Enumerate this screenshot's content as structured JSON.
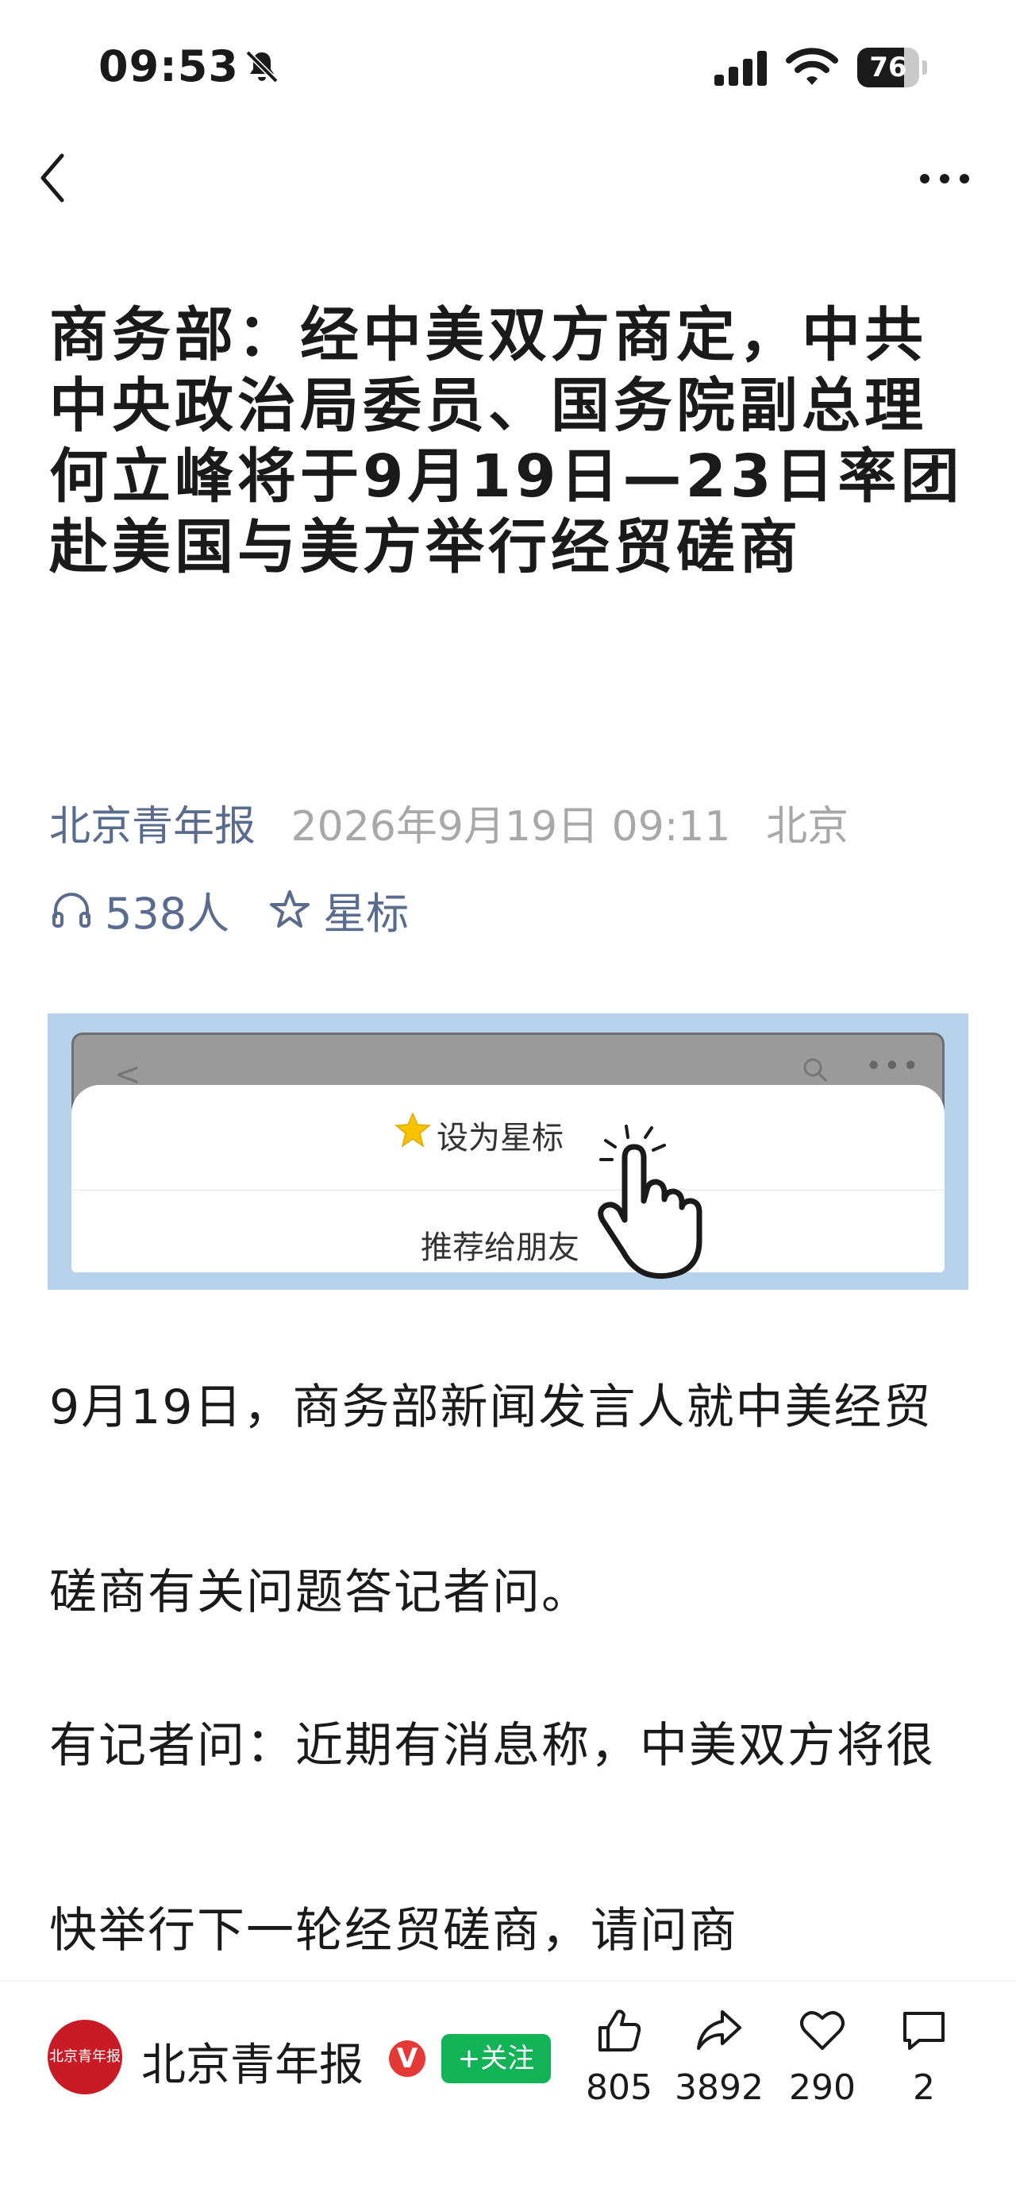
{
  "status_bar": {
    "time": "09:53",
    "battery": "76",
    "battery_level": 0.76
  },
  "nav": {
    "back_icon": "chevron-left-icon",
    "more_icon": "more-dots-icon"
  },
  "article": {
    "title": "商务部：经中美双方商定，中共中央政治局委员、国务院副总理何立峰将于9月19日—23日率团赴美国与美方举行经贸磋商",
    "source": "北京青年报",
    "date": "2026年9月19日 09:11",
    "location": "北京",
    "listen_count": "538人",
    "star_label": "星标",
    "paragraphs": [
      "9月19日，商务部新闻发言人就中美经贸磋商有关问题答记者问。",
      "有记者问：近期有消息称，中美双方将很快举行下一轮经贸磋商，请问商"
    ]
  },
  "banner": {
    "star_option": "设为星标",
    "recommend_option": "推荐给朋友"
  },
  "bottom_bar": {
    "avatar_text": "北京青年报",
    "source_name": "北京青年报",
    "verified": "V",
    "follow_label": "+关注",
    "like_count": "805",
    "share_count": "3892",
    "favorite_count": "290",
    "comment_count": "2"
  },
  "colors": {
    "accent_blue": "#5a6c8e",
    "follow_green": "#12b257",
    "verified_red": "#e53935",
    "banner_bg": "#b7d3ec"
  }
}
